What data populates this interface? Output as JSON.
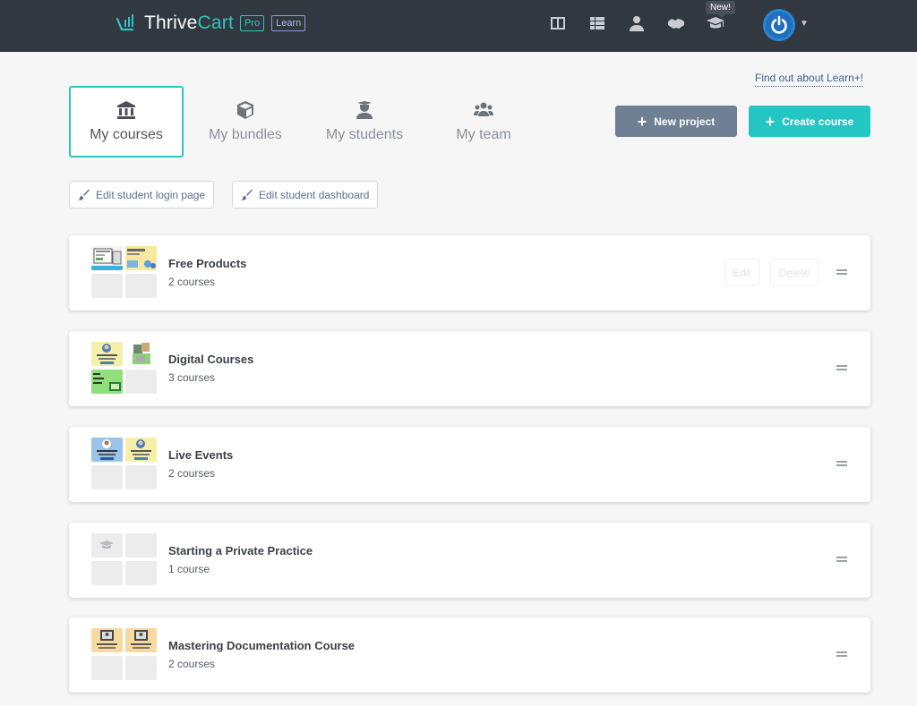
{
  "app": {
    "logo_thrive": "Thrive",
    "logo_cart": "Cart",
    "badge_pro": "Pro",
    "badge_learn": "Learn",
    "new_badge": "New!",
    "nav_icons": [
      "dashboard-icon",
      "products-icon",
      "customer-icon",
      "affiliate-icon",
      "learn-icon"
    ]
  },
  "links": {
    "learn_plus": "Find out about Learn+!"
  },
  "tabs": [
    {
      "label": "My courses",
      "icon": "bank-icon",
      "active": true
    },
    {
      "label": "My bundles",
      "icon": "cube-icon",
      "active": false
    },
    {
      "label": "My students",
      "icon": "student-icon",
      "active": false
    },
    {
      "label": "My team",
      "icon": "team-icon",
      "active": false
    }
  ],
  "buttons": {
    "new_project": "New project",
    "create_course": "Create course",
    "edit_login": "Edit student login page",
    "edit_dashboard": "Edit student dashboard"
  },
  "colors": {
    "accent": "#24c6c3",
    "topbar": "#323840",
    "secondary_button": "#6f7f94"
  },
  "projects": [
    {
      "title": "Free Products",
      "count": "2 courses",
      "edit": "Edit",
      "delete": "Delete"
    },
    {
      "title": "Digital Courses",
      "count": "3 courses"
    },
    {
      "title": "Live Events",
      "count": "2 courses"
    },
    {
      "title": "Starting a Private Practice",
      "count": "1 course"
    },
    {
      "title": "Mastering Documentation Course",
      "count": "2 courses"
    }
  ]
}
